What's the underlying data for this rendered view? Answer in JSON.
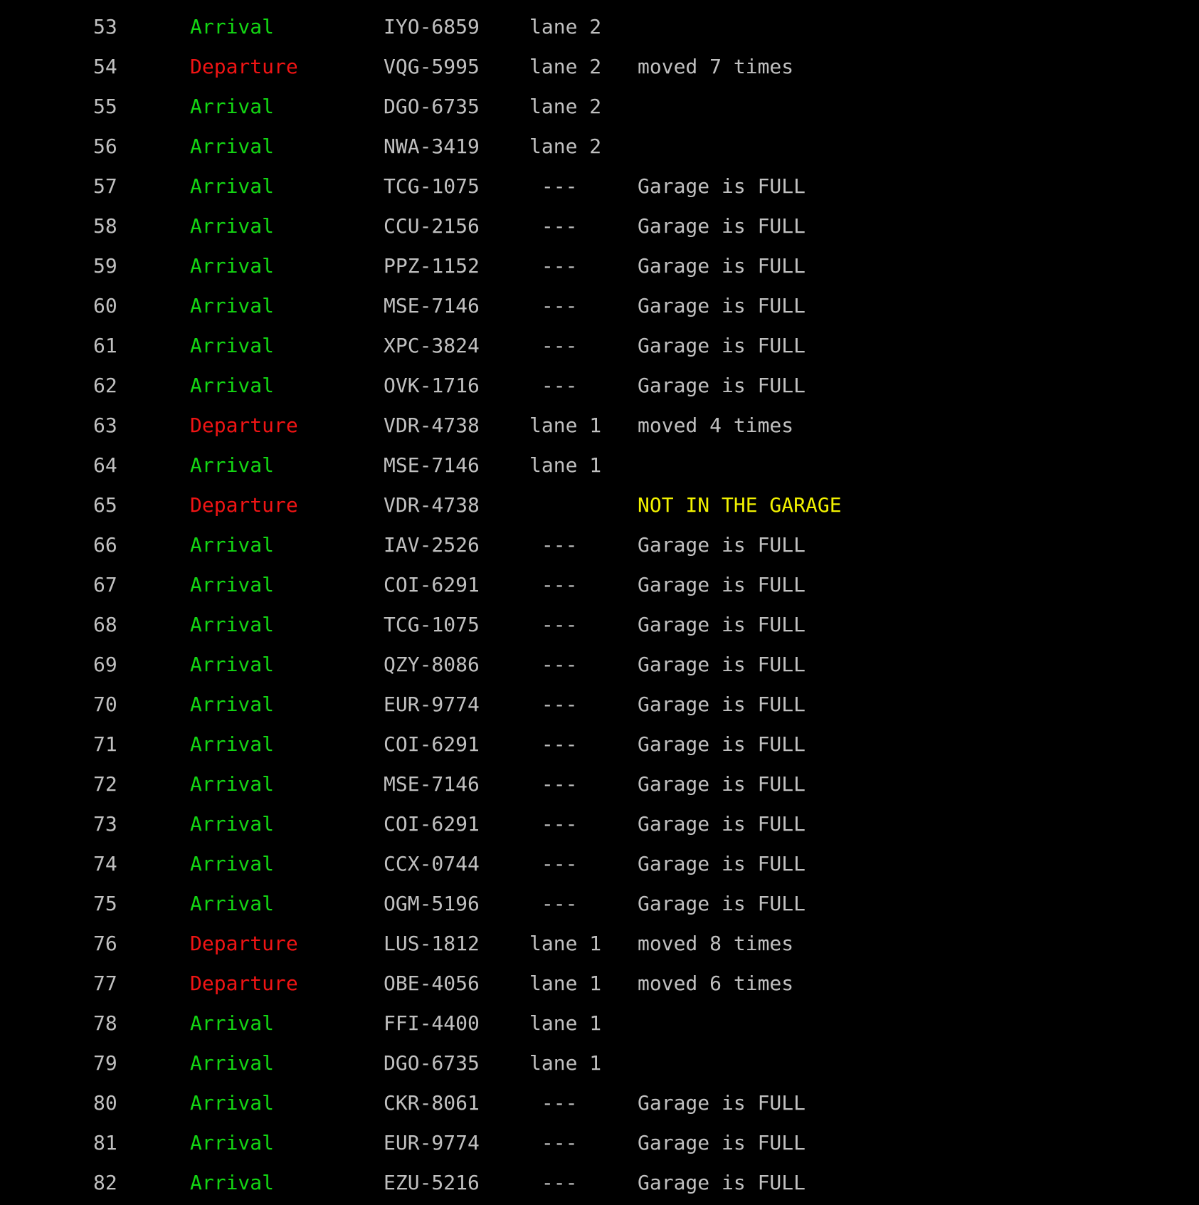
{
  "colors": {
    "background": "#000000",
    "text": "#c0c0c0",
    "arrival": "#13d613",
    "departure": "#f01414",
    "warning": "#f2f200"
  },
  "rows": [
    {
      "num": "53",
      "event": "Arrival",
      "event_type": "arrival",
      "plate": "IYO-6859",
      "lane": "lane 2",
      "note": "",
      "note_type": "normal"
    },
    {
      "num": "54",
      "event": "Departure",
      "event_type": "departure",
      "plate": "VQG-5995",
      "lane": "lane 2",
      "note": "moved 7 times",
      "note_type": "normal"
    },
    {
      "num": "55",
      "event": "Arrival",
      "event_type": "arrival",
      "plate": "DGO-6735",
      "lane": "lane 2",
      "note": "",
      "note_type": "normal"
    },
    {
      "num": "56",
      "event": "Arrival",
      "event_type": "arrival",
      "plate": "NWA-3419",
      "lane": "lane 2",
      "note": "",
      "note_type": "normal"
    },
    {
      "num": "57",
      "event": "Arrival",
      "event_type": "arrival",
      "plate": "TCG-1075",
      "lane": " ---",
      "note": "Garage is FULL",
      "note_type": "normal"
    },
    {
      "num": "58",
      "event": "Arrival",
      "event_type": "arrival",
      "plate": "CCU-2156",
      "lane": " ---",
      "note": "Garage is FULL",
      "note_type": "normal"
    },
    {
      "num": "59",
      "event": "Arrival",
      "event_type": "arrival",
      "plate": "PPZ-1152",
      "lane": " ---",
      "note": "Garage is FULL",
      "note_type": "normal"
    },
    {
      "num": "60",
      "event": "Arrival",
      "event_type": "arrival",
      "plate": "MSE-7146",
      "lane": " ---",
      "note": "Garage is FULL",
      "note_type": "normal"
    },
    {
      "num": "61",
      "event": "Arrival",
      "event_type": "arrival",
      "plate": "XPC-3824",
      "lane": " ---",
      "note": "Garage is FULL",
      "note_type": "normal"
    },
    {
      "num": "62",
      "event": "Arrival",
      "event_type": "arrival",
      "plate": "OVK-1716",
      "lane": " ---",
      "note": "Garage is FULL",
      "note_type": "normal"
    },
    {
      "num": "63",
      "event": "Departure",
      "event_type": "departure",
      "plate": "VDR-4738",
      "lane": "lane 1",
      "note": "moved 4 times",
      "note_type": "normal"
    },
    {
      "num": "64",
      "event": "Arrival",
      "event_type": "arrival",
      "plate": "MSE-7146",
      "lane": "lane 1",
      "note": "",
      "note_type": "normal"
    },
    {
      "num": "65",
      "event": "Departure",
      "event_type": "departure",
      "plate": "VDR-4738",
      "lane": "",
      "note": "NOT IN THE GARAGE",
      "note_type": "warning"
    },
    {
      "num": "66",
      "event": "Arrival",
      "event_type": "arrival",
      "plate": "IAV-2526",
      "lane": " ---",
      "note": "Garage is FULL",
      "note_type": "normal"
    },
    {
      "num": "67",
      "event": "Arrival",
      "event_type": "arrival",
      "plate": "COI-6291",
      "lane": " ---",
      "note": "Garage is FULL",
      "note_type": "normal"
    },
    {
      "num": "68",
      "event": "Arrival",
      "event_type": "arrival",
      "plate": "TCG-1075",
      "lane": " ---",
      "note": "Garage is FULL",
      "note_type": "normal"
    },
    {
      "num": "69",
      "event": "Arrival",
      "event_type": "arrival",
      "plate": "QZY-8086",
      "lane": " ---",
      "note": "Garage is FULL",
      "note_type": "normal"
    },
    {
      "num": "70",
      "event": "Arrival",
      "event_type": "arrival",
      "plate": "EUR-9774",
      "lane": " ---",
      "note": "Garage is FULL",
      "note_type": "normal"
    },
    {
      "num": "71",
      "event": "Arrival",
      "event_type": "arrival",
      "plate": "COI-6291",
      "lane": " ---",
      "note": "Garage is FULL",
      "note_type": "normal"
    },
    {
      "num": "72",
      "event": "Arrival",
      "event_type": "arrival",
      "plate": "MSE-7146",
      "lane": " ---",
      "note": "Garage is FULL",
      "note_type": "normal"
    },
    {
      "num": "73",
      "event": "Arrival",
      "event_type": "arrival",
      "plate": "COI-6291",
      "lane": " ---",
      "note": "Garage is FULL",
      "note_type": "normal"
    },
    {
      "num": "74",
      "event": "Arrival",
      "event_type": "arrival",
      "plate": "CCX-0744",
      "lane": " ---",
      "note": "Garage is FULL",
      "note_type": "normal"
    },
    {
      "num": "75",
      "event": "Arrival",
      "event_type": "arrival",
      "plate": "OGM-5196",
      "lane": " ---",
      "note": "Garage is FULL",
      "note_type": "normal"
    },
    {
      "num": "76",
      "event": "Departure",
      "event_type": "departure",
      "plate": "LUS-1812",
      "lane": "lane 1",
      "note": "moved 8 times",
      "note_type": "normal"
    },
    {
      "num": "77",
      "event": "Departure",
      "event_type": "departure",
      "plate": "OBE-4056",
      "lane": "lane 1",
      "note": "moved 6 times",
      "note_type": "normal"
    },
    {
      "num": "78",
      "event": "Arrival",
      "event_type": "arrival",
      "plate": "FFI-4400",
      "lane": "lane 1",
      "note": "",
      "note_type": "normal"
    },
    {
      "num": "79",
      "event": "Arrival",
      "event_type": "arrival",
      "plate": "DGO-6735",
      "lane": "lane 1",
      "note": "",
      "note_type": "normal"
    },
    {
      "num": "80",
      "event": "Arrival",
      "event_type": "arrival",
      "plate": "CKR-8061",
      "lane": " ---",
      "note": "Garage is FULL",
      "note_type": "normal"
    },
    {
      "num": "81",
      "event": "Arrival",
      "event_type": "arrival",
      "plate": "EUR-9774",
      "lane": " ---",
      "note": "Garage is FULL",
      "note_type": "normal"
    },
    {
      "num": "82",
      "event": "Arrival",
      "event_type": "arrival",
      "plate": "EZU-5216",
      "lane": " ---",
      "note": "Garage is FULL",
      "note_type": "normal"
    }
  ]
}
